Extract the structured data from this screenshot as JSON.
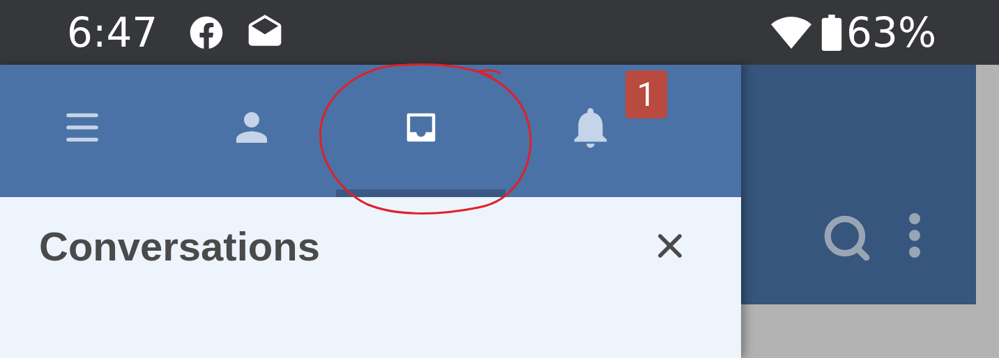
{
  "status_bar": {
    "time": "6:47",
    "battery": "63%"
  },
  "tabs": [
    {
      "kind": "menu",
      "selected": false
    },
    {
      "kind": "profile",
      "selected": false
    },
    {
      "kind": "inbox",
      "selected": true
    },
    {
      "kind": "notifications",
      "selected": false,
      "badge": "1"
    }
  ],
  "panel": {
    "title": "Conversations"
  }
}
